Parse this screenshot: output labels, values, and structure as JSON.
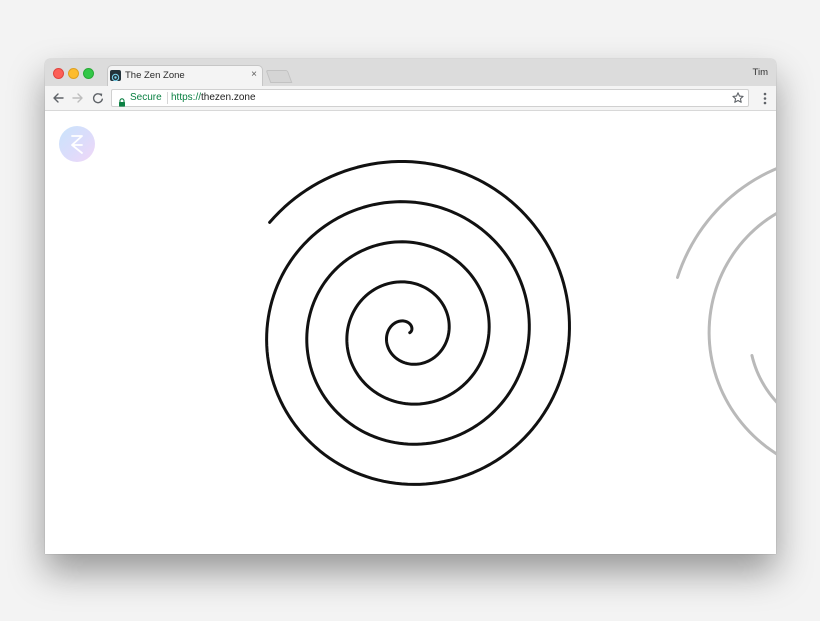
{
  "browser": {
    "tab": {
      "title": "The Zen Zone",
      "close_glyph": "×",
      "favicon": "zen-favicon-icon"
    },
    "profile_name": "Tim",
    "omnibox": {
      "secure_label": "Secure",
      "url_scheme": "https://",
      "url_host": "thezen.zone"
    },
    "icons": {
      "back": "back-arrow-icon",
      "forward": "forward-arrow-icon",
      "reload": "reload-icon",
      "lock": "lock-icon",
      "bookmark": "star-icon",
      "menu": "kebab-menu-icon"
    }
  },
  "page": {
    "logo": {
      "letter": "Z"
    },
    "spirals": [
      {
        "name": "main-spiral",
        "color": "#111111",
        "turns": 4.4
      },
      {
        "name": "secondary-spiral",
        "color": "#b9b9b9",
        "partial": true
      }
    ]
  },
  "colors": {
    "titlebar": "#dcdcdc",
    "toolbar": "#f4f4f4",
    "secure_green": "#0b8043",
    "traffic_close": "#fc5f57",
    "traffic_minimize": "#fdbc2e",
    "traffic_maximize": "#33c748"
  }
}
